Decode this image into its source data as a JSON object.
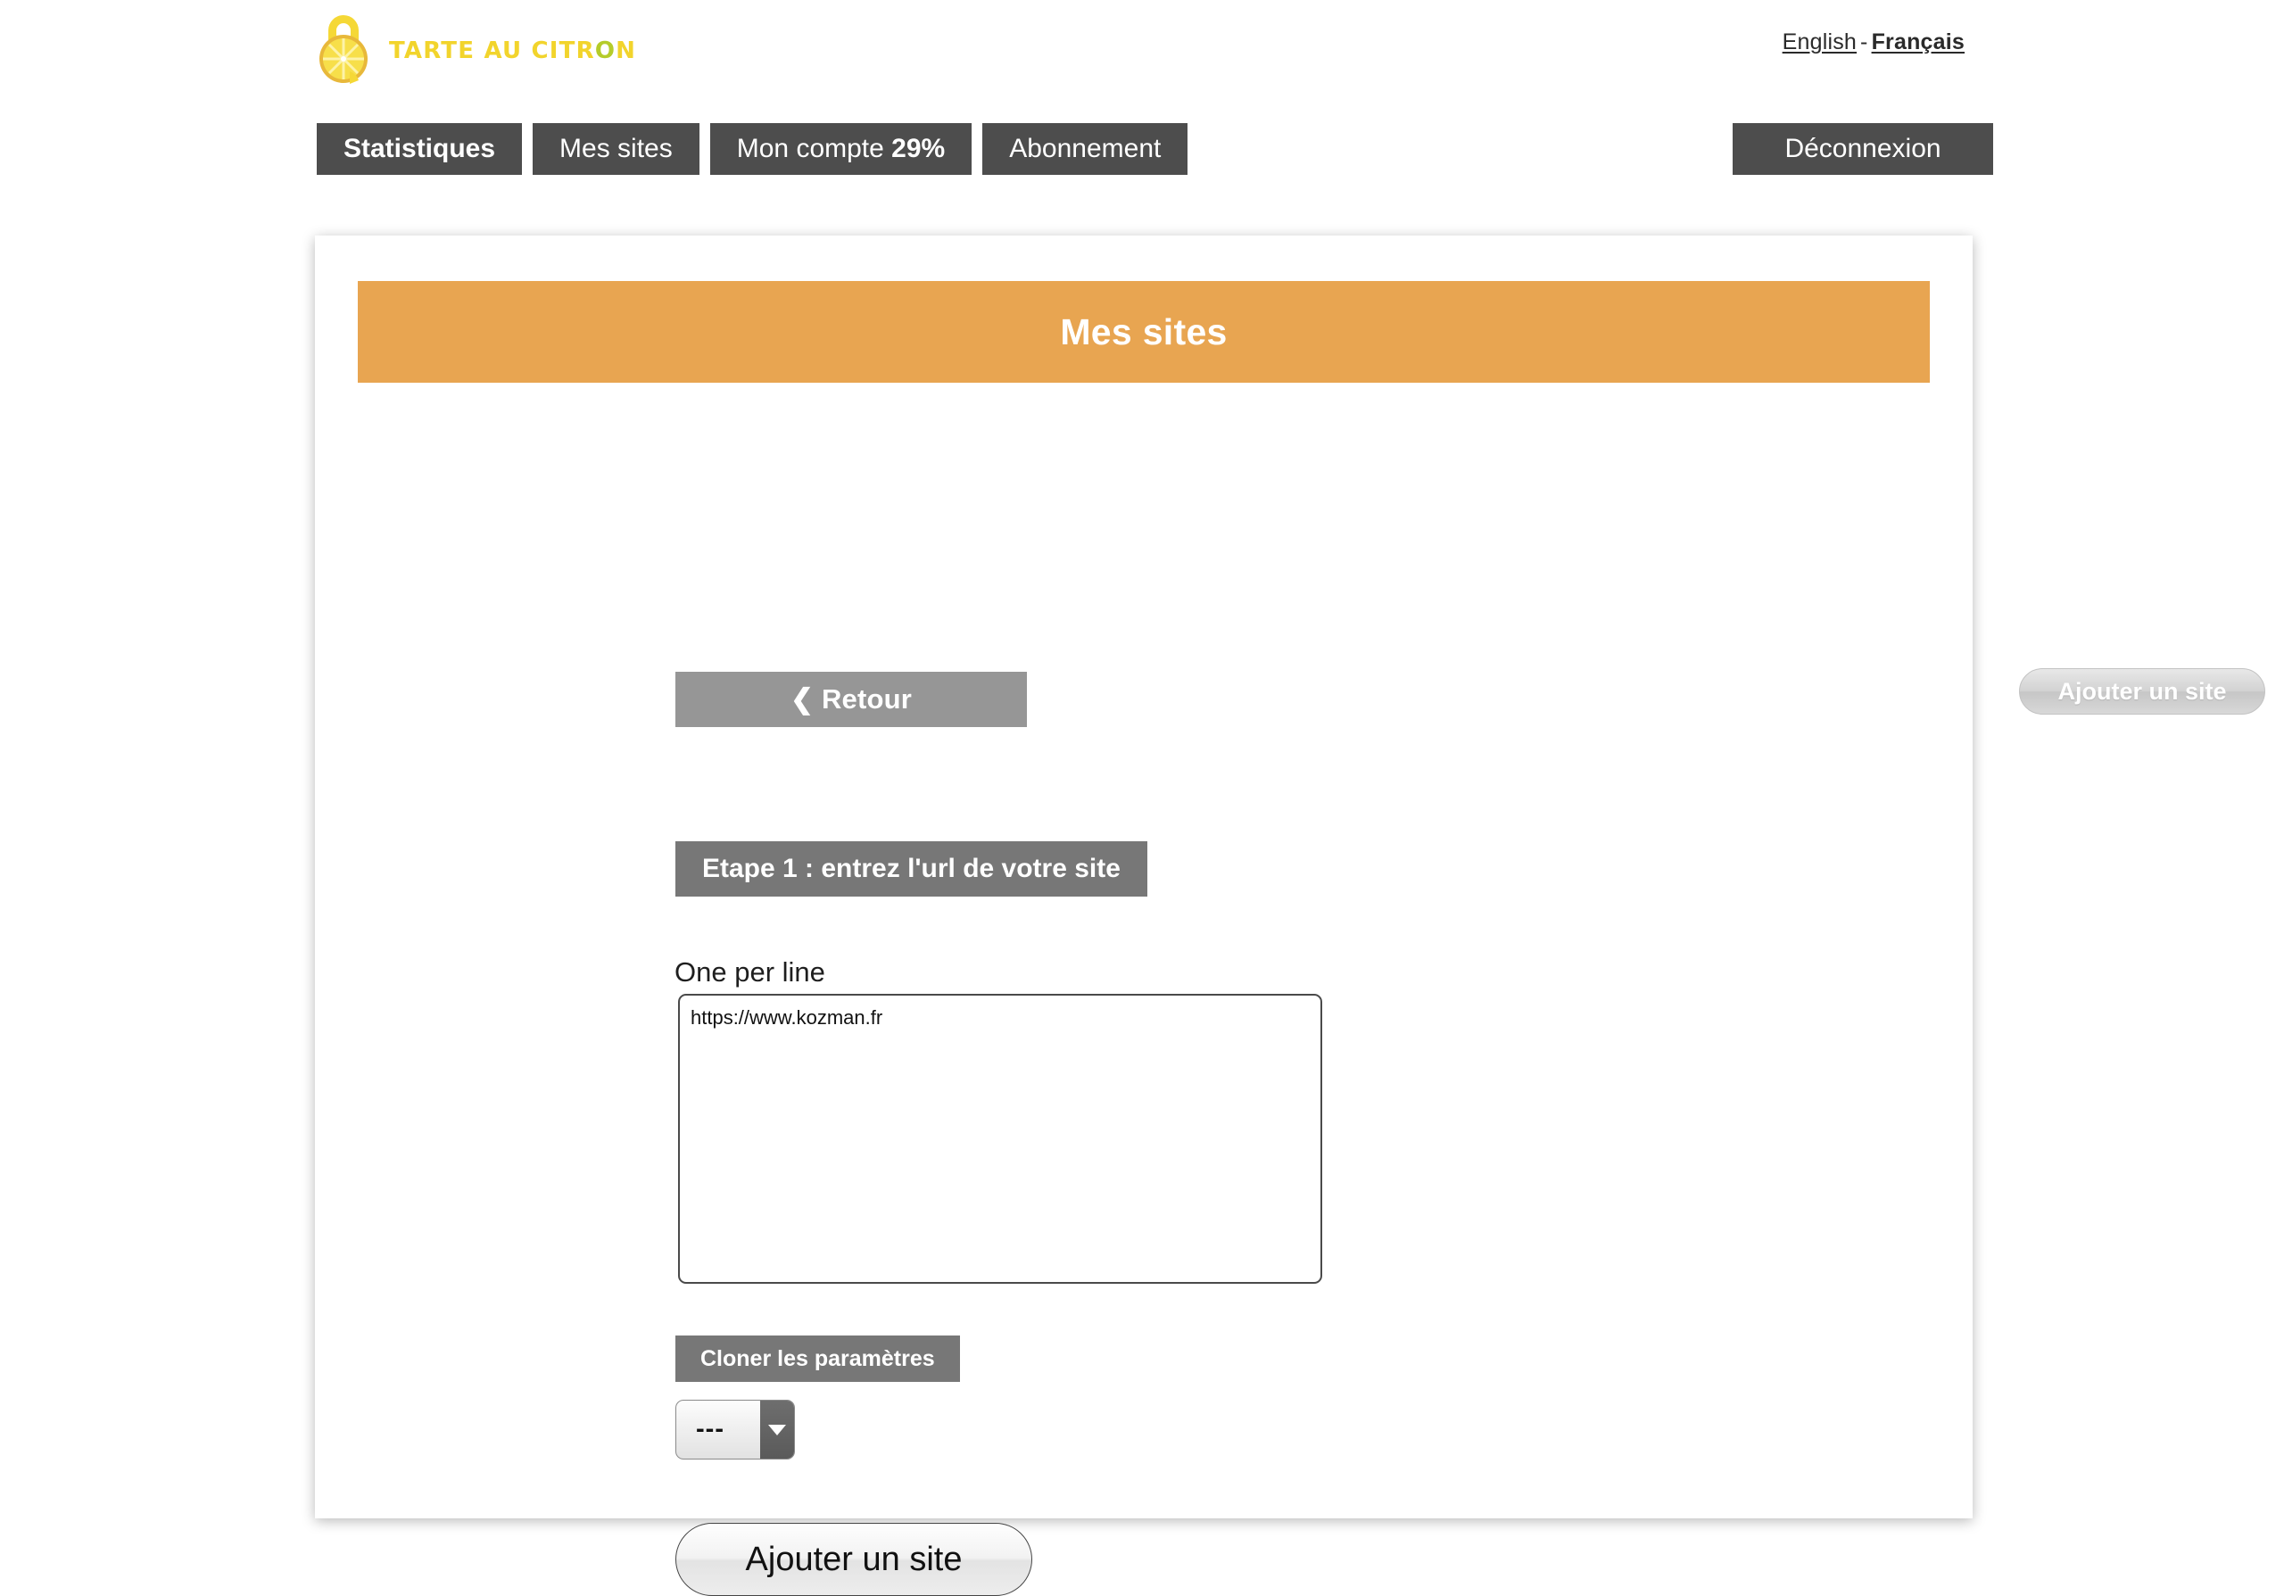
{
  "brand": {
    "logo_icon": "lemon-padlock-icon",
    "name_part1": "TARTE AU CITR",
    "name_o": "O",
    "name_part2": "N",
    "colors": {
      "yellow": "#f2d42c",
      "green": "#b5cc2a",
      "banner_orange": "#e8a551",
      "nav_dark": "#4d4d4d",
      "gray_button": "#777777",
      "retour_gray": "#969696"
    }
  },
  "language": {
    "english": "English",
    "separator": "-",
    "french": "Français",
    "active": "Français"
  },
  "nav": {
    "items": [
      {
        "label": "Statistiques",
        "active": true
      },
      {
        "label": "Mes sites",
        "active": false
      }
    ],
    "account": {
      "label": "Mon compte",
      "percent": "29%"
    },
    "subscription": {
      "label": "Abonnement"
    },
    "logout": {
      "label": "Déconnexion"
    }
  },
  "page": {
    "banner_title": "Mes sites",
    "back_button": "❮ Retour",
    "add_site_top": "Ajouter un site",
    "step_label": "Etape 1 : entrez l'url de votre site",
    "url_field_label": "One per line",
    "url_textarea_value": "https://www.kozman.fr",
    "url_textarea_placeholder": "",
    "clone_button": "Cloner les paramètres",
    "clone_select_value": "---",
    "clone_select_options": [
      "---"
    ],
    "add_site_bottom": "Ajouter un site"
  }
}
